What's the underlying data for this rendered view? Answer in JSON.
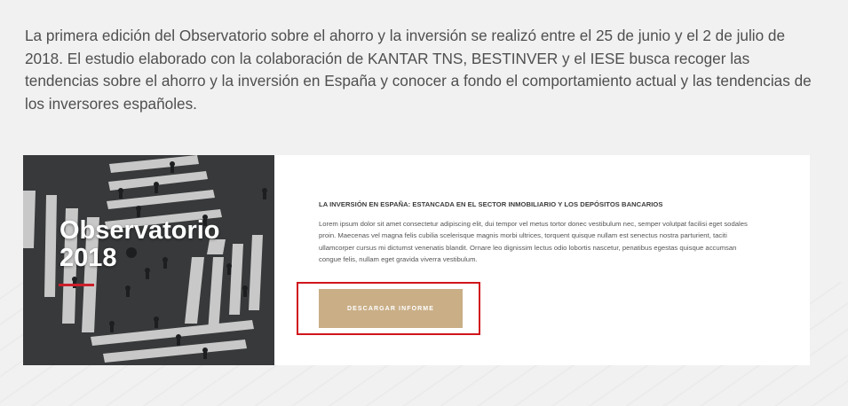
{
  "intro": {
    "text": "La primera edición del Observatorio sobre el ahorro y la inversión se realizó entre el 25 de junio y el 2 de julio de 2018. El estudio elaborado con la colaboración de KANTAR TNS, BESTINVER y el IESE busca recoger las tendencias sobre el ahorro y la inversión en España y conocer a fondo el comportamiento actual y las tendencias de los inversores españoles."
  },
  "card": {
    "image": {
      "title_line1": "Observatorio",
      "title_line2": "2018",
      "accent_color": "#cc1f2a"
    },
    "article": {
      "title": "LA INVERSIÓN EN ESPAÑA: ESTANCADA EN EL SECTOR INMOBILIARIO Y LOS DEPÓSITOS BANCARIOS",
      "body": "Lorem ipsum dolor sit amet consectetur adipiscing elit, dui tempor vel metus tortor donec vestibulum nec, semper volutpat facilisi eget sodales proin. Maecenas vel magna felis cubilia scelerisque magnis morbi ultrices, torquent quisque nullam est senectus nostra parturient, taciti ullamcorper cursus mi dictumst venenatis blandit. Ornare leo dignissim lectus odio lobortis nascetur, penatibus egestas quisque accumsan congue felis, nullam eget gravida viverra vestibulum."
    },
    "cta": {
      "label": "DESCARGAR INFORME",
      "color": "#c9ae86",
      "highlight_color": "#d0161c"
    }
  }
}
